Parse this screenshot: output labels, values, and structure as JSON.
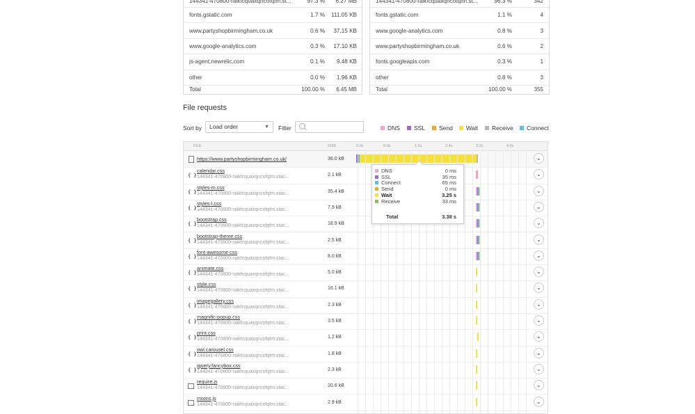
{
  "left_table": {
    "rows": [
      {
        "name": "144341-470800-raikfcquaxqncofqfm.st...",
        "pct": "97.3 %",
        "value": "6.27 MB"
      },
      {
        "name": "fonts.gstatic.com",
        "pct": "1.7 %",
        "value": "111.05 KB"
      },
      {
        "name": "www.partyshopbirmingham.co.uk",
        "pct": "0.6 %",
        "value": "37.15 KB"
      },
      {
        "name": "www.google-analytics.com",
        "pct": "0.3 %",
        "value": "17.10 KB"
      },
      {
        "name": "js-agent.newrelic.com",
        "pct": "0.1 %",
        "value": "9.48 KB"
      },
      {
        "name": "other",
        "pct": "0.0 %",
        "value": "1.96 KB"
      }
    ],
    "total": {
      "name": "Total",
      "pct": "100.00 %",
      "value": "6.45 MB"
    }
  },
  "right_table": {
    "rows": [
      {
        "name": "144341-470800-raikfcquaxqncofqfm.st...",
        "pct": "96.3 %",
        "value": "342"
      },
      {
        "name": "fonts.gstatic.com",
        "pct": "1.1 %",
        "value": "4"
      },
      {
        "name": "www.google-analytics.com",
        "pct": "0.8 %",
        "value": "3"
      },
      {
        "name": "www.partyshopbirmingham.co.uk",
        "pct": "0.6 %",
        "value": "2"
      },
      {
        "name": "fonts.googleapis.com",
        "pct": "0.3 %",
        "value": "1"
      },
      {
        "name": "other",
        "pct": "0.8 %",
        "value": "3"
      }
    ],
    "total": {
      "name": "Total",
      "pct": "100.00 %",
      "value": "355"
    }
  },
  "file_requests": {
    "title": "File requests",
    "sort_label": "Sort by",
    "sort_value": "Load order",
    "filter_label": "Filter",
    "filter_placeholder": "",
    "legend": [
      {
        "label": "DNS",
        "color": "#f2a6c9"
      },
      {
        "label": "SSL",
        "color": "#9a67e0"
      },
      {
        "label": "Send",
        "color": "#f5a623"
      },
      {
        "label": "Wait",
        "color": "#f5e13a"
      },
      {
        "label": "Receive",
        "color": "#b8b8b8"
      },
      {
        "label": "Connect",
        "color": "#4fc3e8"
      }
    ],
    "header": {
      "file": "FILE",
      "size": "SIZE",
      "ticks": [
        "0.0s",
        "0.0s",
        "1.5s",
        "2.4s",
        "3.2s",
        "4.0s"
      ]
    },
    "rows": [
      {
        "name": "https://www.partyshopbirmingham.co.uk/",
        "sub": "",
        "size": "36.0 kB",
        "icon": "doc",
        "highlight": true
      },
      {
        "name": "calendar.css",
        "sub": "144341-470800-raikfcquaxqncofqfm.stac...",
        "size": "2.1 kB",
        "icon": "css"
      },
      {
        "name": "styles-m.css",
        "sub": "144341-470800-raikfcquaxqncofqfm.stac...",
        "size": "35.4 kB",
        "icon": "css"
      },
      {
        "name": "styles-l.css",
        "sub": "144341-470800-raikfcquaxqncofqfm.stac...",
        "size": "7.9 kB",
        "icon": "css"
      },
      {
        "name": "bootstrap.css",
        "sub": "144341-470800-raikfcquaxqncofqfm.stac...",
        "size": "18.9 kB",
        "icon": "css"
      },
      {
        "name": "bootstrap-theme.css",
        "sub": "144341-470800-raikfcquaxqncofqfm.stac...",
        "size": "2.5 kB",
        "icon": "css"
      },
      {
        "name": "font-awesome.css",
        "sub": "144341-470800-raikfcquaxqncofqfm.stac...",
        "size": "8.0 kB",
        "icon": "css"
      },
      {
        "name": "animate.css",
        "sub": "144341-470800-raikfcquaxqncofqfm.stac...",
        "size": "5.0 kB",
        "icon": "css"
      },
      {
        "name": "style.css",
        "sub": "144341-470800-raikfcquaxqncofqfm.stac...",
        "size": "16.1 kB",
        "icon": "css"
      },
      {
        "name": "imagegallery.css",
        "sub": "144341-470800-raikfcquaxqncofqfm.stac...",
        "size": "2.3 kB",
        "icon": "css"
      },
      {
        "name": "magnific-popup.css",
        "sub": "144341-470800-raikfcquaxqncofqfm.stac...",
        "size": "3.5 kB",
        "icon": "css"
      },
      {
        "name": "print.css",
        "sub": "144341-470800-raikfcquaxqncofqfm.stac...",
        "size": "1.2 kB",
        "icon": "css"
      },
      {
        "name": "owl.carousel.css",
        "sub": "144341-470800-raikfcquaxqncofqfm.stac...",
        "size": "1.8 kB",
        "icon": "css"
      },
      {
        "name": "jquery.fancybox.css",
        "sub": "144341-470800-raikfcquaxqncofqfm.stac...",
        "size": "2.3 kB",
        "icon": "css"
      },
      {
        "name": "require.js",
        "sub": "144341-470800-raikfcquaxqncofqfm.stac...",
        "size": "20.6 kB",
        "icon": "img"
      },
      {
        "name": "mixins.js",
        "sub": "144341-470800-raikfcquaxqncofqfm.stac...",
        "size": "2.9 kB",
        "icon": "img"
      }
    ],
    "tooltip": {
      "rows": [
        {
          "label": "DNS",
          "value": "0 ms",
          "color": "#f2a6c9"
        },
        {
          "label": "SSL",
          "value": "35 ms",
          "color": "#9a67e0"
        },
        {
          "label": "Connect",
          "value": "65 ms",
          "color": "#4fc3e8"
        },
        {
          "label": "Send",
          "value": "0 ms",
          "color": "#f5a623"
        },
        {
          "label": "Wait",
          "value": "3.25 s",
          "color": "#f5e13a"
        },
        {
          "label": "Receive",
          "value": "33 ms",
          "color": "#8bc34a"
        }
      ],
      "total_label": "Total",
      "total_value": "3.38 s"
    }
  }
}
